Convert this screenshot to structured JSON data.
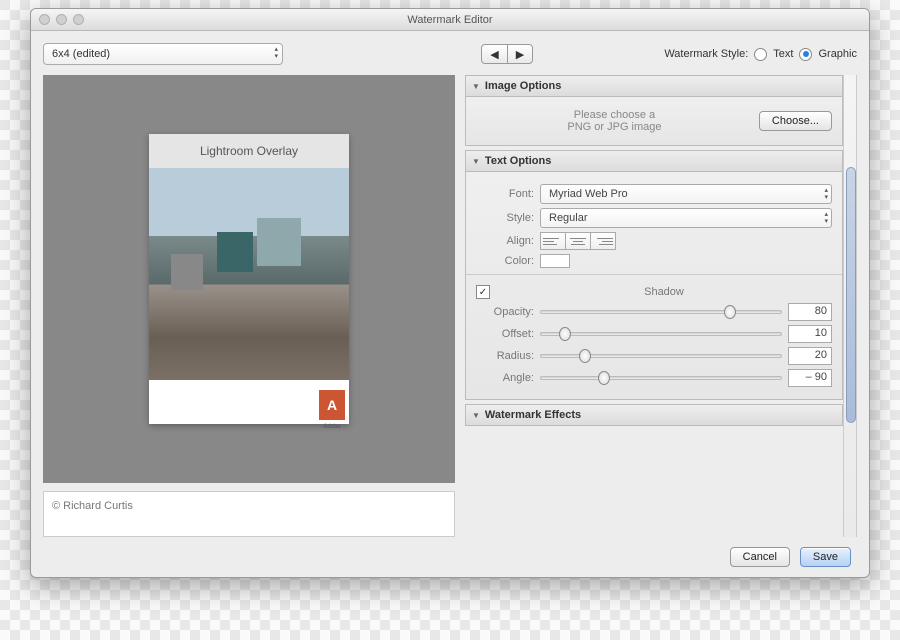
{
  "window": {
    "title": "Watermark Editor"
  },
  "preset": {
    "label": "6x4 (edited)"
  },
  "style": {
    "label": "Watermark Style:",
    "text_label": "Text",
    "graphic_label": "Graphic",
    "selected": "Graphic"
  },
  "preview": {
    "overlay_title": "Lightroom Overlay",
    "logo_name": "Adobe"
  },
  "copyright": {
    "text": "© Richard Curtis"
  },
  "panels": {
    "image_options": {
      "title": "Image Options",
      "helptext": "Please choose a\nPNG or JPG image",
      "choose_label": "Choose..."
    },
    "text_options": {
      "title": "Text Options",
      "font_label": "Font:",
      "font_value": "Myriad Web Pro",
      "style_label": "Style:",
      "style_value": "Regular",
      "align_label": "Align:",
      "color_label": "Color:",
      "shadow": {
        "enabled": true,
        "title": "Shadow",
        "opacity_label": "Opacity:",
        "opacity_value": "80",
        "offset_label": "Offset:",
        "offset_value": "10",
        "radius_label": "Radius:",
        "radius_value": "20",
        "angle_label": "Angle:",
        "angle_value": "– 90"
      }
    },
    "watermark_effects": {
      "title": "Watermark Effects"
    }
  },
  "footer": {
    "cancel_label": "Cancel",
    "save_label": "Save"
  }
}
